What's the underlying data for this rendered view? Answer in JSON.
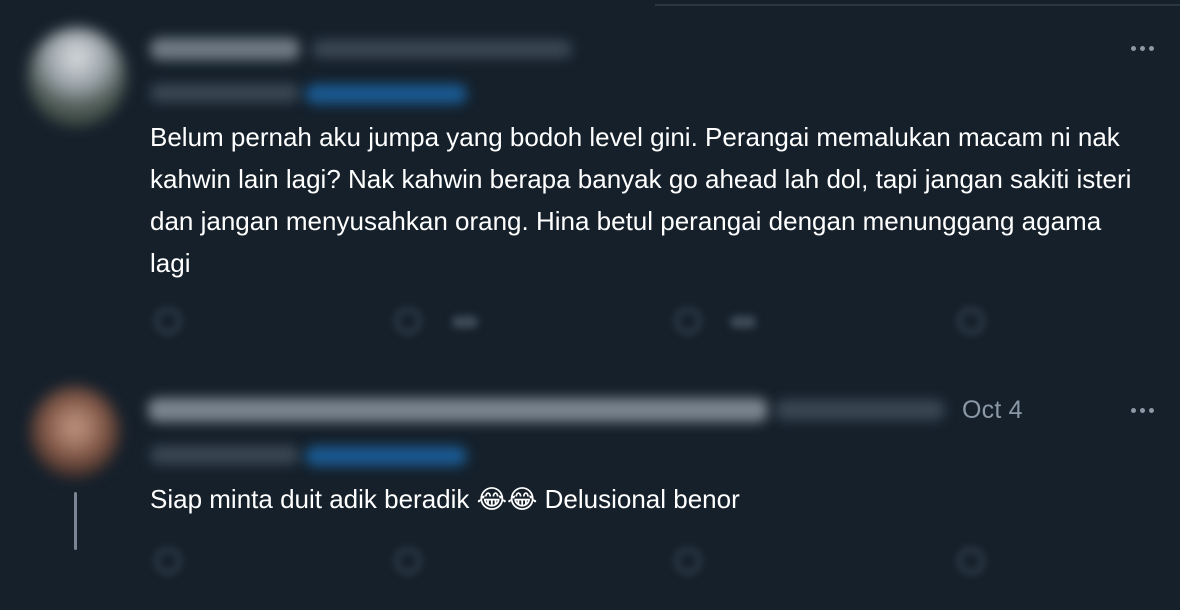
{
  "tweets": [
    {
      "text": "Belum pernah aku jumpa yang bodoh level gini. Perangai memalukan macam ni nak kahwin lain lagi? Nak kahwin berapa banyak go ahead lah dol, tapi jangan sakiti isteri dan jangan menyusahkan orang. Hina betul perangai dengan menunggang agama lagi"
    },
    {
      "date": "Oct 4",
      "text_before": "Siap minta duit adik beradik ",
      "emoji": "😂😂",
      "text_after": " Delusional benor"
    }
  ],
  "icons": {
    "more": "more-horizontal-icon",
    "reply": "reply-icon",
    "retweet": "retweet-icon",
    "like": "like-icon",
    "share": "share-icon"
  },
  "colors": {
    "background": "#15202b",
    "text": "#ffffff",
    "muted": "#8b98a5",
    "mention": "#1d9bf0"
  }
}
